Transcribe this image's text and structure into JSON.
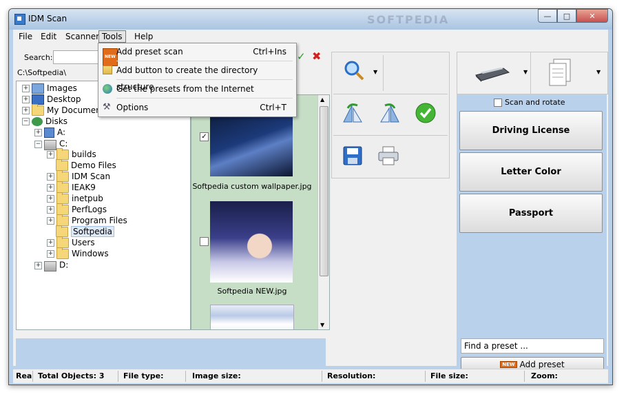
{
  "window": {
    "title": "IDM Scan",
    "watermark": "SOFTPEDIA"
  },
  "menu": [
    "File",
    "Edit",
    "Scanner",
    "Tools",
    "Help"
  ],
  "tools_menu": [
    {
      "label": "Add preset scan",
      "shortcut": "Ctrl+Ins",
      "icon": "new-badge-icon",
      "badge": "NEW"
    },
    {
      "label": "Add button to create the directory structure",
      "shortcut": "",
      "icon": "directory-tree-icon"
    },
    {
      "label": "Get the presets from the Internet",
      "shortcut": "",
      "icon": "globe-icon"
    },
    {
      "label": "Options",
      "shortcut": "Ctrl+T",
      "icon": "tools-icon"
    }
  ],
  "search": {
    "label": "Search:",
    "value": ""
  },
  "path": "C:\\Softpedia\\",
  "tree": [
    {
      "label": "Images"
    },
    {
      "label": "Desktop"
    },
    {
      "label": "My Documents"
    },
    {
      "label": "Disks"
    },
    {
      "label": "A:"
    },
    {
      "label": "C:"
    },
    {
      "label": "builds"
    },
    {
      "label": "Demo Files"
    },
    {
      "label": "IDM Scan"
    },
    {
      "label": "IEAK9"
    },
    {
      "label": "inetpub"
    },
    {
      "label": "PerfLogs"
    },
    {
      "label": "Program Files"
    },
    {
      "label": "Softpedia"
    },
    {
      "label": "Users"
    },
    {
      "label": "Windows"
    },
    {
      "label": "D:"
    }
  ],
  "thumbnails": [
    {
      "caption": "Softpedia custom wallpaper.jpg",
      "checked": true
    },
    {
      "caption": "Softpedia NEW.jpg",
      "checked": false
    },
    {
      "caption": "",
      "checked": false
    }
  ],
  "scan_rotate": {
    "label": "Scan and rotate",
    "checked": false
  },
  "presets": [
    "Driving License",
    "Letter Color",
    "Passport"
  ],
  "find_preset": {
    "value": "Find a preset ..."
  },
  "add_preset": {
    "label": "Add preset",
    "badge": "NEW"
  },
  "status": {
    "c0": "Rea",
    "c1": "Total Objects: 3",
    "c2": "File type:",
    "c3": "Image size:",
    "c4": "Resolution:",
    "c5": "File size:",
    "c6": "Zoom:"
  },
  "colors": {
    "accent": "#b9d1ea",
    "thumb_bg": "#c6ddc6",
    "close": "#c75050"
  }
}
